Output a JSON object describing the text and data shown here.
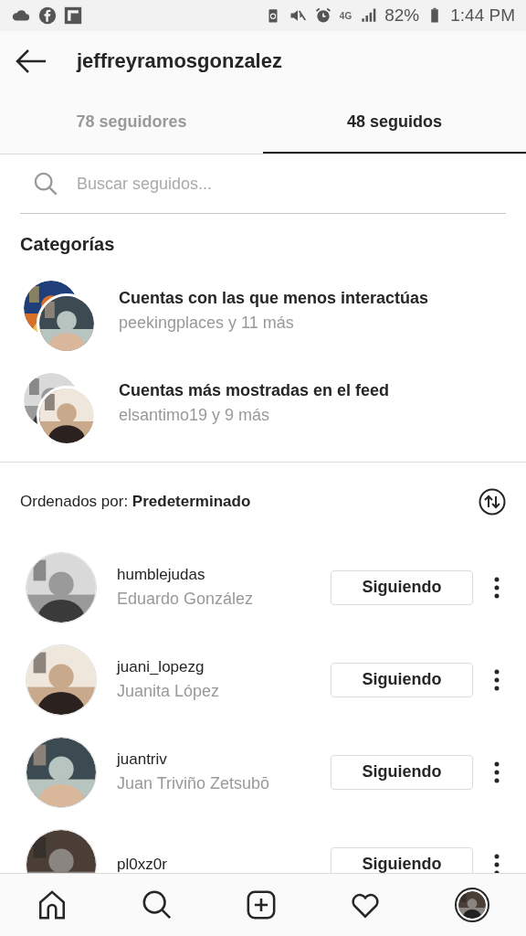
{
  "status_bar": {
    "network": "4G",
    "battery": "82%",
    "time": "1:44 PM"
  },
  "header": {
    "title": "jeffreyramosgonzalez"
  },
  "tabs": [
    {
      "label": "78 seguidores",
      "selected": false
    },
    {
      "label": "48 seguidos",
      "selected": true
    }
  ],
  "search": {
    "placeholder": "Buscar seguidos..."
  },
  "categories_title": "Categorías",
  "categories": [
    {
      "title": "Cuentas con las que menos interactúas",
      "subtitle": "peekingplaces y 11 más"
    },
    {
      "title": "Cuentas más mostradas en el feed",
      "subtitle": "elsantimo19 y 9 más"
    }
  ],
  "sort": {
    "label": "Ordenados por: ",
    "value": "Predeterminado"
  },
  "accounts": [
    {
      "username": "humblejudas",
      "name": "Eduardo González",
      "button": "Siguiendo"
    },
    {
      "username": "juani_lopezg",
      "name": "Juanita López",
      "button": "Siguiendo"
    },
    {
      "username": "juantriv",
      "name": "Juan Triviño Zetsubō",
      "button": "Siguiendo"
    },
    {
      "username": "pl0xz0r",
      "button": "Siguiendo"
    }
  ]
}
